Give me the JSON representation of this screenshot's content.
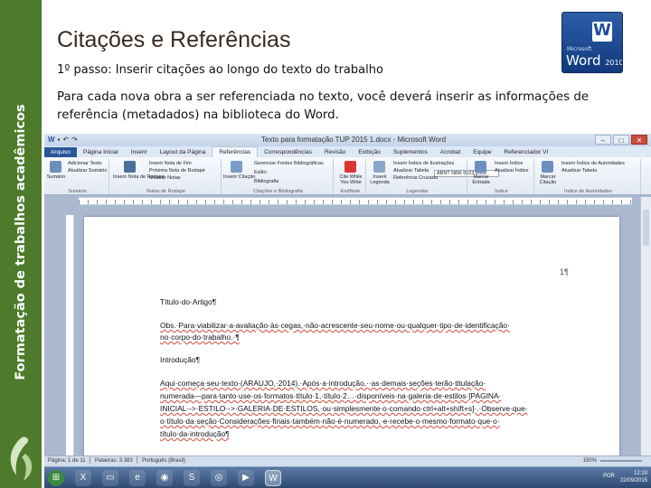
{
  "sidebar": {
    "label": "Formatação de trabalhos acadêmicos",
    "color": "#4e7a2b"
  },
  "slide": {
    "title": "Citações e Referências",
    "subtitle": "1º passo: Inserir citações ao longo do texto do trabalho",
    "paragraph": "Para cada nova obra a ser referenciada no texto, você deverá inserir as informações  de referência (metadados) na biblioteca do Word.",
    "logo": {
      "brand": "Microsoft",
      "product": "Word",
      "year": "2010"
    }
  },
  "word": {
    "window_title": "Texto para formatação TUP 2015 1.docx - Microsoft Word",
    "tabs": [
      "Arquivo",
      "Página Inicial",
      "Inserir",
      "Layout da Página",
      "Referências",
      "Correspondências",
      "Revisão",
      "Exibição",
      "Suplementos",
      "Acrobat",
      "Equipe",
      "Referenciador VI"
    ],
    "active_tab": "Referências",
    "ribbon": {
      "toc": {
        "button": "Sumário",
        "items": [
          "Adicionar Texto",
          "Atualizar Sumário"
        ],
        "label": "Sumário"
      },
      "footnotes": {
        "button": "Inserir Nota de Rodapé",
        "items": [
          "Inserir Nota de Fim",
          "Próxima Nota de Rodapé",
          "Mostrar Notas"
        ],
        "label": "Notas de Rodapé"
      },
      "citations": {
        "button": "Inserir Citação",
        "items": [
          "Gerenciar Fontes Bibliográficas",
          "Estilo:",
          "Bibliografia"
        ],
        "style_value": "ABNT NBR 6023:2002",
        "label": "Citações e Bibliografia"
      },
      "citewhile": {
        "button": "Cite While You Write",
        "label": "EndNote"
      },
      "captions": {
        "button": "Inserir Legenda",
        "items": [
          "Inserir Índice de Ilustrações",
          "Atualizar Tabela",
          "Referência Cruzada"
        ],
        "label": "Legendas"
      },
      "index": {
        "button": "Marcar Entrada",
        "items": [
          "Inserir Índice",
          "Atualizar Índice"
        ],
        "label": "Índice"
      },
      "authorities": {
        "button": "Marcar Citação",
        "items": [
          "Inserir Índice de Autoridades",
          "Atualizar Tabela"
        ],
        "label": "Índice de Autoridades"
      }
    },
    "document": {
      "page_number": "1¶",
      "lines": [
        "Título·do·Artigo¶",
        "Obs.·Para·viabilizar·a·avaliação·às·cegas,·não·acrescente·seu·nome·ou·qualquer·tipo·de·identificação·",
        "no·corpo·do·trabalho.·¶",
        "Introdução¶",
        "Aqui·começa·seu·texto·(ARAUJO,·2014).·Após·a·introdução,··as·demais·seções·terão·titulação·",
        "numerada—para·tanto·use·os·formatos·título·1,·título·2…·disponíveis·na·galeria·de·estilos·[PAGINA·",
        "INICIAL·->·ESTILO·->·GALERIA·DE·ESTILOS,·ou·simplesmente·o·comando·ctrl+alt+shift+s]·.·Observe·que·",
        "o·título·da·seção·Considerações·finais·também·não·é·numerado,·e·recebe·o·mesmo·formato·que·o·",
        "título·da·introdução¶"
      ]
    },
    "statusbar": {
      "page": "Página: 1 de 11",
      "words": "Palavras: 3.383",
      "language": "Português (Brasil)",
      "zoom": "150%"
    },
    "taskbar": {
      "time": "12:10",
      "date": "22/09/2015",
      "locale": "POR"
    }
  }
}
